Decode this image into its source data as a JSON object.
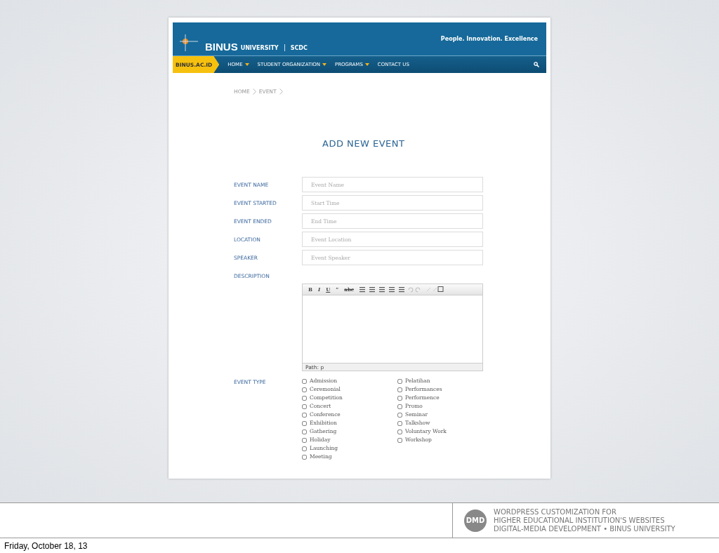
{
  "site": {
    "logo": "BINUS",
    "logo_suffix": "UNIVERSITY",
    "section": "SCDC",
    "tagline": "People. Innovation. Excellence"
  },
  "nav": {
    "home_tab": "BINUS.AC.ID",
    "items": [
      {
        "label": "HOME",
        "dropdown": true
      },
      {
        "label": "STUDENT ORGANIZATION",
        "dropdown": true
      },
      {
        "label": "PROGRAMS",
        "dropdown": true
      },
      {
        "label": "CONTACT US",
        "dropdown": false
      }
    ]
  },
  "breadcrumb": [
    "HOME",
    "EVENT"
  ],
  "title": "ADD NEW EVENT",
  "fields": [
    {
      "label": "EVENT NAME",
      "placeholder": "Event Name"
    },
    {
      "label": "EVENT STARTED",
      "placeholder": "Start Time"
    },
    {
      "label": "EVENT ENDED",
      "placeholder": "End Time"
    },
    {
      "label": "LOCATION",
      "placeholder": "Event Location"
    },
    {
      "label": "SPEAKER",
      "placeholder": "Event Speaker"
    }
  ],
  "description": {
    "label": "DESCRIPTION",
    "toolbar": [
      "B",
      "I",
      "U",
      "“",
      "abc"
    ],
    "path": "Path: p"
  },
  "event_type": {
    "label": "EVENT TYPE",
    "columns": [
      [
        {
          "label": "Admission",
          "checked": false
        },
        {
          "label": "Ceremonial",
          "checked": false
        },
        {
          "label": "Competition",
          "checked": false
        },
        {
          "label": "Concert",
          "checked": false
        },
        {
          "label": "Conference",
          "checked": false
        },
        {
          "label": "Exhibition",
          "checked": false
        },
        {
          "label": "Gathering",
          "checked": false
        },
        {
          "label": "Holiday",
          "checked": false
        },
        {
          "label": "Launching",
          "checked": false
        },
        {
          "label": "Meeting",
          "checked": false
        }
      ],
      [
        {
          "label": "Pelatihan",
          "checked": false
        },
        {
          "label": "Performances",
          "checked": false
        },
        {
          "label": "Performence",
          "checked": false
        },
        {
          "label": "Promo",
          "checked": false
        },
        {
          "label": "Seminar",
          "checked": false
        },
        {
          "label": "Talkshow",
          "checked": false
        },
        {
          "label": "Voluntary Work",
          "checked": false
        },
        {
          "label": "Workshop",
          "checked": false
        }
      ]
    ]
  },
  "slide_footer": {
    "logo": "DMD",
    "lines": [
      "WORDPRESS CUSTOMIZATION FOR",
      "HIGHER EDUCATIONAL INSTITUTION'S WEBSITES",
      "DIGITAL-MEDIA DEVELOPMENT • BINUS UNIVERSITY"
    ]
  },
  "date": "Friday, October 18, 13"
}
